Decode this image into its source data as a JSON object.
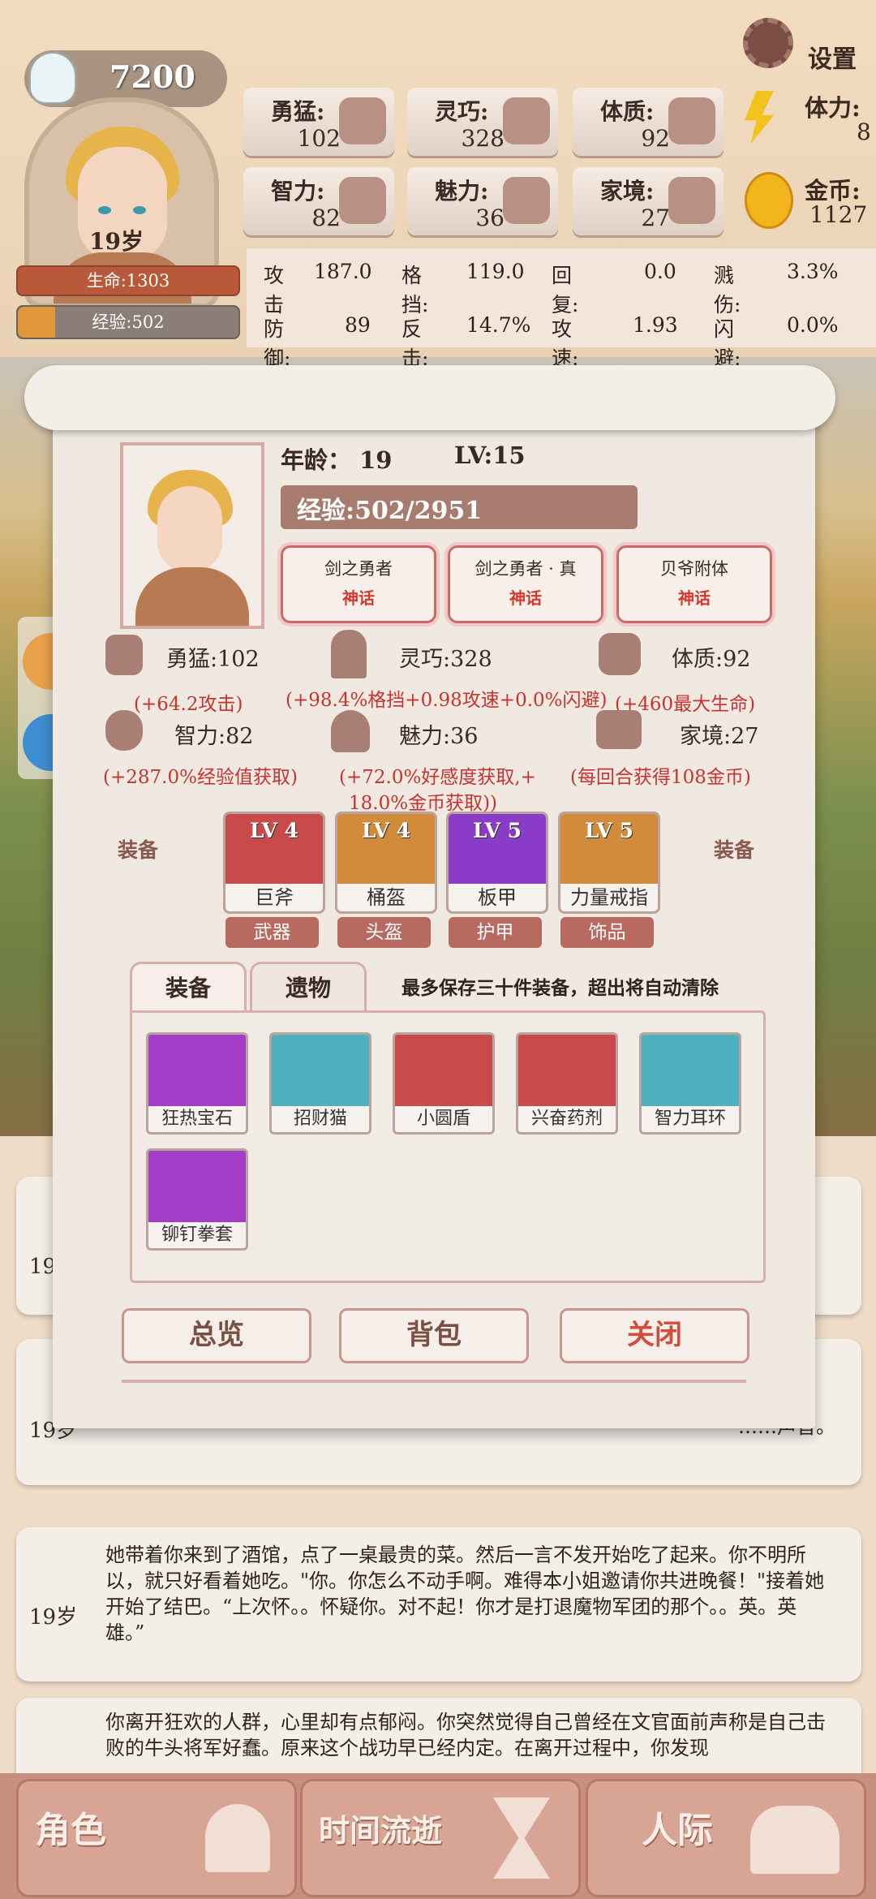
{
  "header": {
    "coins_top": "7200",
    "age_label": "19岁",
    "life_label": "生命:1303",
    "life_pct": 100,
    "exp_label": "经验:502",
    "exp_pct": 17,
    "settings_label": "设置"
  },
  "stats": [
    {
      "label": "勇猛:",
      "value": "102",
      "icon": "fist-icon"
    },
    {
      "label": "灵巧:",
      "value": "328",
      "icon": "cloak-icon"
    },
    {
      "label": "体质:",
      "value": "92",
      "icon": "arm-icon"
    },
    {
      "label": "智力:",
      "value": "82",
      "icon": "brain-icon"
    },
    {
      "label": "魅力:",
      "value": "36",
      "icon": "flower-icon"
    },
    {
      "label": "家境:",
      "value": "27",
      "icon": "coin-stack-icon"
    }
  ],
  "side_stats": [
    {
      "label": "体力:",
      "value": "8",
      "icon": "lightning-icon"
    },
    {
      "label": "金币:",
      "value": "1127",
      "icon": "gold-coin-icon"
    }
  ],
  "battle": [
    {
      "label": "攻击",
      "value": "187.0"
    },
    {
      "label": "格挡:",
      "value": "119.0"
    },
    {
      "label": "回复:",
      "value": "0.0"
    },
    {
      "label": "溅伤:",
      "value": "3.3%"
    },
    {
      "label": "防御:",
      "value": "89"
    },
    {
      "label": "反击:",
      "value": "14.7%"
    },
    {
      "label": "攻速:",
      "value": "1.93"
    },
    {
      "label": "闪避:",
      "value": "0.0%"
    }
  ],
  "panel": {
    "age_text": "年龄： 19",
    "lv_text": "LV:15",
    "exp_text": "经验:502/2951",
    "titles": [
      {
        "name": "剑之勇者",
        "rarity": "神话"
      },
      {
        "name": "剑之勇者 · 真",
        "rarity": "神话"
      },
      {
        "name": "贝爷附体",
        "rarity": "神话"
      }
    ],
    "attrs": [
      {
        "label": "勇猛:102",
        "effect": "(+64.2攻击)"
      },
      {
        "label": "灵巧:328",
        "effect": "(+98.4%格挡+0.98攻速+0.0%闪避)"
      },
      {
        "label": "体质:92",
        "effect": "(+460最大生命)"
      },
      {
        "label": "智力:82",
        "effect": "(+287.0%经验值获取)"
      },
      {
        "label": "魅力:36",
        "effect_line1": "(+72.0%好感度获取,+",
        "effect_line2": "18.0%金币获取))"
      },
      {
        "label": "家境:27",
        "effect": "(每回合获得108金币)"
      }
    ],
    "equip_side_label": "装备",
    "equipped": [
      {
        "level": "LV 4",
        "name": "巨斧",
        "slot": "武器",
        "bg": "#c94a4a"
      },
      {
        "level": "LV 4",
        "name": "桶盔",
        "slot": "头盔",
        "bg": "#d28b3a"
      },
      {
        "level": "LV 5",
        "name": "板甲",
        "slot": "护甲",
        "bg": "#8a3bc8"
      },
      {
        "level": "LV 5",
        "name": "力量戒指",
        "slot": "饰品",
        "bg": "#d28b3a"
      }
    ],
    "tabs": [
      "装备",
      "遗物"
    ],
    "notice": "最多保存三十件装备，超出将自动清除",
    "inventory": [
      {
        "name": "狂热宝石",
        "bg": "#a33cc6"
      },
      {
        "name": "招财猫",
        "bg": "#4fb0c0"
      },
      {
        "name": "小圆盾",
        "bg": "#c94a4a"
      },
      {
        "name": "兴奋药剂",
        "bg": "#c94a4a"
      },
      {
        "name": "智力耳环",
        "bg": "#4fb0c0"
      },
      {
        "name": "铆钉拳套",
        "bg": "#a33cc6"
      }
    ],
    "buttons": [
      "总览",
      "背包",
      "关闭"
    ]
  },
  "log": [
    {
      "age": "19岁",
      "text": ""
    },
    {
      "age": "19岁",
      "text": "……声音。"
    },
    {
      "age": "19岁",
      "text": "她带着你来到了酒馆，点了一桌最贵的菜。然后一言不发开始吃了起来。你不明所以，就只好看着她吃。\"你。你怎么不动手啊。难得本小姐邀请你共进晚餐！\"接着她开始了结巴。“上次怀。。怀疑你。对不起！你才是打退魔物军团的那个。。英。英雄。”"
    },
    {
      "age": "",
      "text": "你离开狂欢的人群，心里却有点郁闷。你突然觉得自己曾经在文官面前声称是自己击败的牛头将军好蠢。原来这个战功早已经内定。在离开过程中，你发现"
    }
  ],
  "nav": [
    "角色",
    "时间流逝",
    "人际"
  ]
}
